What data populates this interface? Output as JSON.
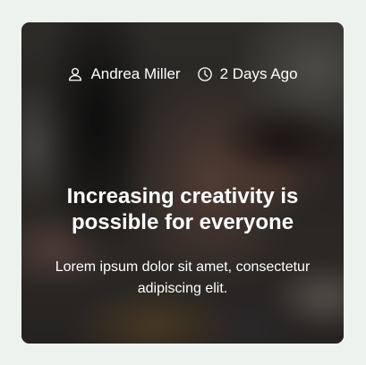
{
  "card": {
    "author": "Andrea Miller",
    "date": "2 Days Ago",
    "title": "Increasing creativity is possible for everyone",
    "excerpt": "Lorem ipsum dolor sit amet, consectetur adipiscing elit.",
    "icons": {
      "author": "user-icon",
      "date": "clock-icon"
    }
  },
  "colors": {
    "page_background": "#eef2ee",
    "text": "#ffffff"
  }
}
